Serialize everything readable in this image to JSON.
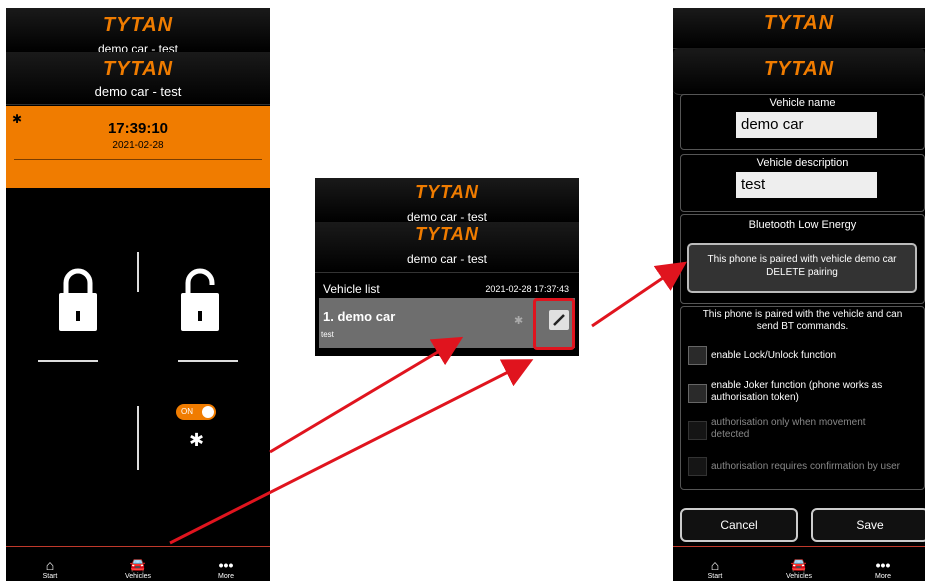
{
  "brand": "TYTAN",
  "screen1": {
    "ghost_subtitle": "demo car - test",
    "subtitle": "demo car - test",
    "time": "17:39:10",
    "date": "2021-02-28",
    "toggle_label": "ON",
    "nav": [
      "Start",
      "Vehicles",
      "More"
    ]
  },
  "screen2": {
    "ghost_subtitle": "demo car - test",
    "subtitle": "demo car - test",
    "list_label": "Vehicle list",
    "list_timestamp": "2021-02-28 17:37:43",
    "item_name": "1. demo car",
    "item_desc": "test"
  },
  "screen3": {
    "name_label": "Vehicle name",
    "name_value": "demo car",
    "desc_label": "Vehicle description",
    "desc_value": "test",
    "ble_title": "Bluetooth Low Energy",
    "pair_line1": "This phone is paired with vehicle demo car",
    "pair_line2": "DELETE pairing",
    "info_line1": "This phone is paired with the vehicle and can",
    "info_line2": "send BT commands.",
    "opt1": "enable Lock/Unlock function",
    "opt2_line1": "enable Joker function (phone works as",
    "opt2_line2": "authorisation token)",
    "opt3_line1": "authorisation only when movement",
    "opt3_line2": "detected",
    "opt4": "authorisation requires confirmation by user",
    "cancel": "Cancel",
    "save": "Save",
    "nav": [
      "Start",
      "Vehicles",
      "More"
    ]
  },
  "colors": {
    "accent": "#f07c00",
    "arrow": "#e0141e",
    "background": "#000000"
  }
}
